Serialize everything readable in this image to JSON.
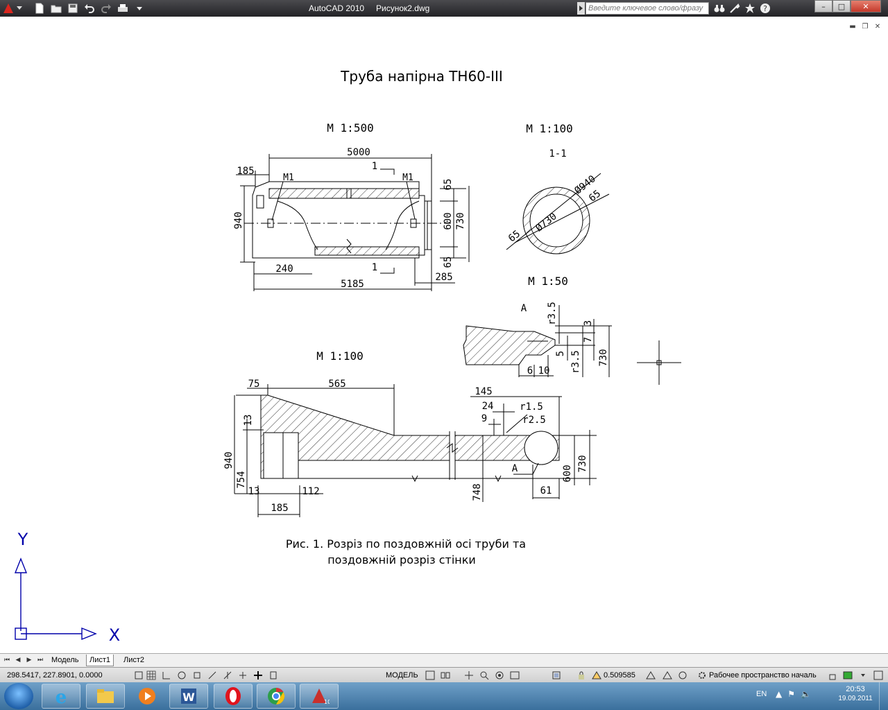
{
  "window": {
    "app_name": "AutoCAD 2010",
    "document_name": "Рисунок2.dwg",
    "search_placeholder": "Введите ключевое слово/фразу",
    "quick_access": [
      "app-menu-icon",
      "new-icon",
      "open-icon",
      "save-icon",
      "undo-icon",
      "redo-icon",
      "plot-icon",
      "dropdown-icon"
    ],
    "info_tools": [
      "binoculars-icon",
      "tools-icon",
      "favorites-icon",
      "help-icon"
    ],
    "controls": {
      "minimize": "–",
      "maximize": "□",
      "close": "✕"
    }
  },
  "drawing": {
    "title": "Труба напірна ТН60-ІІІ",
    "scales": {
      "main": "М 1:500",
      "section": "М 1:100",
      "detail": "М 1:50",
      "wall": "М 1:100"
    },
    "section_label": "1-1",
    "detail_label": "А",
    "caption_line1": "Рис. 1. Розріз по поздовжній осі труби та",
    "caption_line2": "поздовжній розріз стінки",
    "main_dims": {
      "d5000": "5000",
      "d185": "185",
      "m1_left": "М1",
      "m1_right": "М1",
      "cut_top": "1",
      "cut_bottom": "1",
      "d940": "940",
      "d65_top": "65",
      "d600": "600",
      "d730": "730",
      "d65_bottom": "65",
      "d240": "240",
      "d5185": "5185",
      "d285": "285"
    },
    "section_dims": {
      "d940": "Ø940",
      "d730": "Ø730",
      "d65a": "65",
      "d65b": "65"
    },
    "detail_dims": {
      "r35_top": "r3.5",
      "d3": "3",
      "d7": "7",
      "d5": "5",
      "r35_bottom": "r3.5",
      "d730": "730",
      "d6": "6",
      "d10": "10"
    },
    "wall_dims": {
      "d75": "75",
      "d565": "565",
      "d145": "145",
      "d24": "24",
      "r15": "r1.5",
      "d9": "9",
      "r25": "r2.5",
      "d13_top": "13",
      "d940": "940",
      "d754": "754",
      "d13_bottom": "13",
      "d112": "112",
      "d185": "185",
      "d748": "748",
      "d600": "600",
      "d730": "730",
      "d61": "61",
      "label_a": "А"
    },
    "ucs": {
      "y": "Y",
      "x": "X"
    }
  },
  "layout_tabs": {
    "tabs": [
      "Модель",
      "Лист1",
      "Лист2"
    ],
    "active": "Лист1"
  },
  "statusbar": {
    "coordinates": "298.5417, 227.8901, 0.0000",
    "space": "МОДЕЛЬ",
    "annotation_scale": "0.509585",
    "workspace": "Рабочее пространство началь"
  },
  "taskbar": {
    "apps": [
      "explorer",
      "media-player",
      "word",
      "opera",
      "chrome",
      "autocad"
    ],
    "language": "EN",
    "time": "20:53",
    "date": "19.09.2011"
  }
}
